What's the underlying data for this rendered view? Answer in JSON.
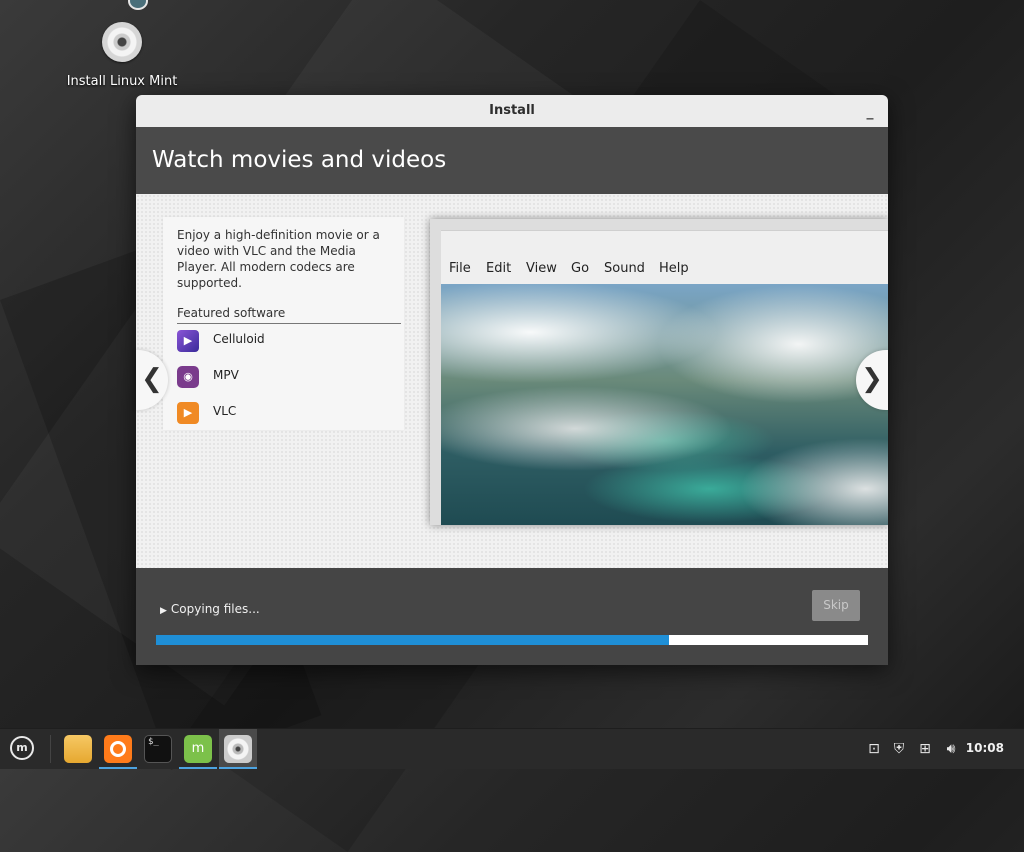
{
  "desktop": {
    "icons": [
      {
        "label": "Install Linux Mint",
        "icon": "cd-disc-icon"
      }
    ]
  },
  "window": {
    "title": "Install",
    "minimize_label": "_",
    "slide": {
      "title": "Watch movies and videos",
      "description": "Enjoy a high-definition movie or a video with VLC and the Media Player. All modern codecs are supported.",
      "featured_title": "Featured software",
      "apps": [
        {
          "name": "Celluloid",
          "icon": "celluloid-icon",
          "color": "#6a3fc4"
        },
        {
          "name": "MPV",
          "icon": "mpv-icon",
          "color": "#7a3b8c"
        },
        {
          "name": "VLC",
          "icon": "vlc-icon",
          "color": "#f08a24"
        }
      ],
      "screenshot_menu": [
        "File",
        "Edit",
        "View",
        "Go",
        "Sound",
        "Help"
      ]
    },
    "nav": {
      "prev": "❮",
      "next": "❯"
    },
    "status_text": "Copying files...",
    "skip_label": "Skip",
    "progress_percent": 72,
    "accent": "#1f8fd6"
  },
  "taskbar": {
    "launchers": [
      {
        "name": "files",
        "icon": "folder-icon"
      },
      {
        "name": "firefox",
        "icon": "firefox-icon"
      },
      {
        "name": "terminal",
        "icon": "terminal-icon",
        "glyph": "$_"
      },
      {
        "name": "software-manager",
        "icon": "mintinstall-icon",
        "glyph": "m"
      },
      {
        "name": "installer",
        "icon": "cd-disc-icon"
      }
    ],
    "menu_glyph": "m",
    "tray": [
      "update-manager-icon",
      "shield-icon",
      "network-icon",
      "volume-icon"
    ],
    "clock": "10:08"
  }
}
